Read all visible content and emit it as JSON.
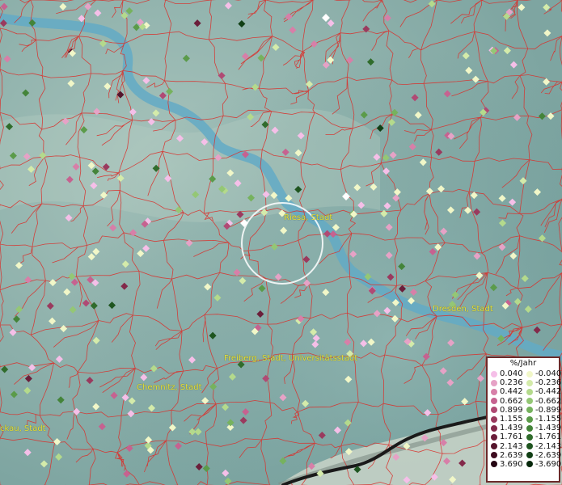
{
  "map": {
    "places": [
      {
        "id": "riesa",
        "name": "Riesa, Stadt"
      },
      {
        "id": "dresden",
        "name": "Dresden, Stadt"
      },
      {
        "id": "freiberg",
        "name": "Freiberg, Stadt, Universitätsstadt"
      },
      {
        "id": "chemnitz",
        "name": "Chemnitz, Stadt"
      },
      {
        "id": "zwickau",
        "name": "ckau, Stadt"
      }
    ],
    "colors": {
      "water": "#63aac6",
      "boundaries": "#d8322e",
      "selection_ring": "#ffffff"
    }
  },
  "legend": {
    "title": "%/Jahr",
    "positive": [
      {
        "label": "0.040",
        "color": "#f5bfe8"
      },
      {
        "label": "0.236",
        "color": "#e6a2c6"
      },
      {
        "label": "0.442",
        "color": "#d77fa8"
      },
      {
        "label": "0.662",
        "color": "#c66290"
      },
      {
        "label": "0.899",
        "color": "#b04a74"
      },
      {
        "label": "1.155",
        "color": "#9a3a5e"
      },
      {
        "label": "1.439",
        "color": "#83294a"
      },
      {
        "label": "1.761",
        "color": "#6b1e3a"
      },
      {
        "label": "2.143",
        "color": "#55152c"
      },
      {
        "label": "2.639",
        "color": "#3e0c20"
      },
      {
        "label": "3.690",
        "color": "#250613"
      }
    ],
    "negative": [
      {
        "label": "-0.040",
        "color": "#f1f7c8"
      },
      {
        "label": "-0.236",
        "color": "#d4ebaa"
      },
      {
        "label": "-0.442",
        "color": "#b4da8c"
      },
      {
        "label": "-0.662",
        "color": "#94c775"
      },
      {
        "label": "-0.899",
        "color": "#76b25e"
      },
      {
        "label": "-1.155",
        "color": "#5b9b4a"
      },
      {
        "label": "-1.439",
        "color": "#44843a"
      },
      {
        "label": "-1.761",
        "color": "#306c2c"
      },
      {
        "label": "-2.143",
        "color": "#1f5520"
      },
      {
        "label": "-2.639",
        "color": "#113f15"
      },
      {
        "label": "-3.690",
        "color": "#06280b"
      }
    ]
  }
}
